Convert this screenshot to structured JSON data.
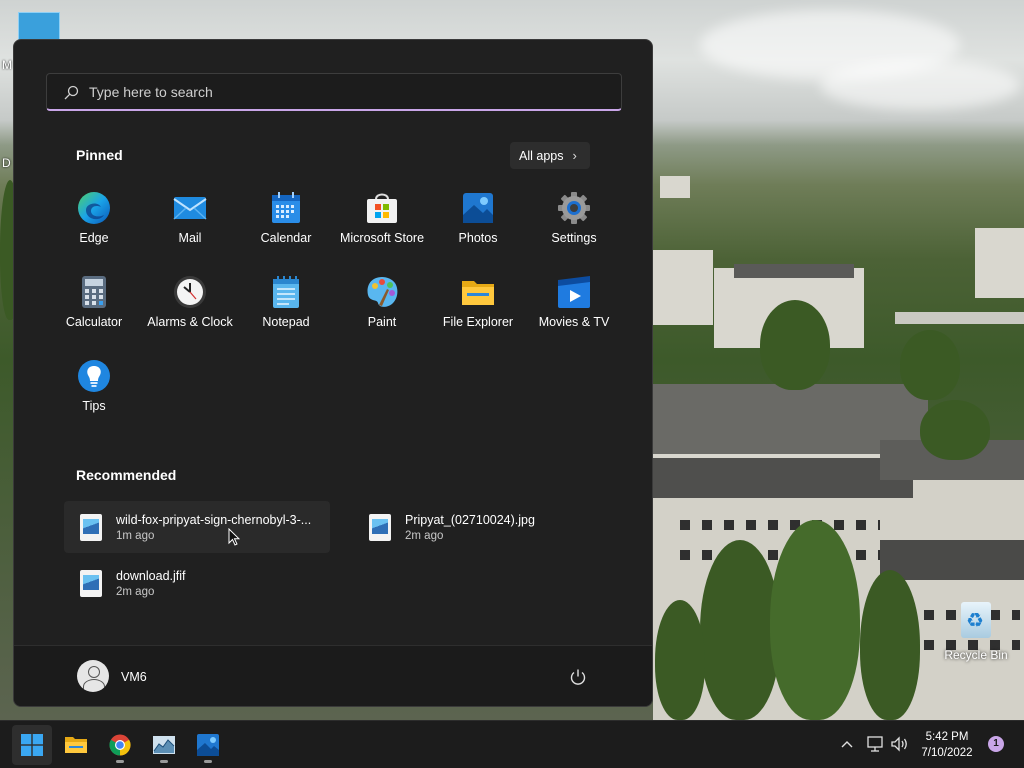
{
  "desktop": {
    "label_m": "M",
    "label_d": "D",
    "recycle_bin": "Recycle Bin"
  },
  "start_menu": {
    "search": {
      "placeholder": "Type here to search",
      "value": ""
    },
    "pinned_title": "Pinned",
    "all_apps_label": "All apps",
    "pinned": [
      {
        "label": "Edge",
        "icon": "edge-icon"
      },
      {
        "label": "Mail",
        "icon": "mail-icon"
      },
      {
        "label": "Calendar",
        "icon": "calendar-icon"
      },
      {
        "label": "Microsoft Store",
        "icon": "store-icon"
      },
      {
        "label": "Photos",
        "icon": "photos-icon"
      },
      {
        "label": "Settings",
        "icon": "gear-icon"
      },
      {
        "label": "Calculator",
        "icon": "calculator-icon"
      },
      {
        "label": "Alarms & Clock",
        "icon": "clock-icon"
      },
      {
        "label": "Notepad",
        "icon": "notepad-icon"
      },
      {
        "label": "Paint",
        "icon": "paint-palette-icon"
      },
      {
        "label": "File Explorer",
        "icon": "folder-icon"
      },
      {
        "label": "Movies & TV",
        "icon": "play-icon"
      },
      {
        "label": "Tips",
        "icon": "lightbulb-icon"
      }
    ],
    "recommended_title": "Recommended",
    "recommended": [
      {
        "name": "wild-fox-pripyat-sign-chernobyl-3-...",
        "time": "1m ago"
      },
      {
        "name": "Pripyat_(02710024).jpg",
        "time": "2m ago"
      },
      {
        "name": "download.jfif",
        "time": "2m ago"
      }
    ],
    "user_name": "VM6"
  },
  "taskbar": {
    "apps": [
      {
        "name": "start-button",
        "icon": "windows-logo-icon"
      },
      {
        "name": "file-explorer",
        "icon": "folder-icon"
      },
      {
        "name": "chrome",
        "icon": "chrome-icon"
      },
      {
        "name": "task-manager",
        "icon": "chart-image-icon"
      },
      {
        "name": "photos",
        "icon": "photos-icon"
      }
    ],
    "time": "5:42 PM",
    "date": "7/10/2022",
    "notification_count": "1"
  },
  "colors": {
    "menu_bg": "#202020",
    "accent": "#c9a6e8",
    "taskbar_bg": "#1c1c1c"
  }
}
